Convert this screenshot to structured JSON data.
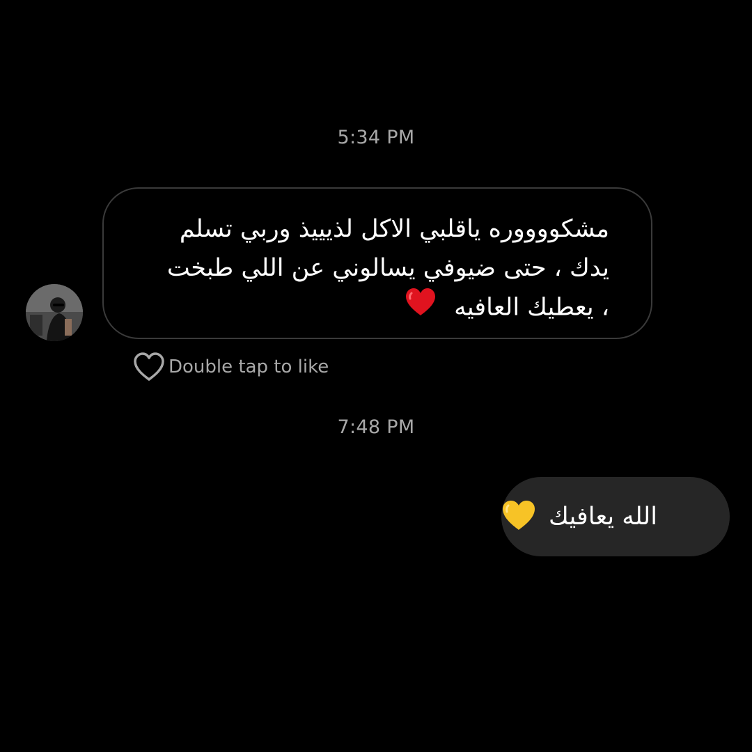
{
  "conversation": {
    "timestamp_1": "5:34 PM",
    "incoming_message": {
      "lines": [
        "مشكووووره ياقلبي الاكل لذيييذ وربي تسلم",
        "يدك ، حتى ضيوفي يسالوني عن اللي طبخت",
        "، يعطيك العافيه"
      ],
      "emoji": "red-heart-emoji",
      "like_hint": "Double tap to like"
    },
    "timestamp_2": "7:48 PM",
    "outgoing_message": {
      "text": "الله يعافيك",
      "emoji": "yellow-heart-emoji"
    }
  },
  "colors": {
    "background": "#000000",
    "timestamp": "#a8a8a8",
    "incoming_border": "#3a3a3a",
    "outgoing_bubble": "#262626",
    "red_heart": "#e0131f",
    "yellow_heart": "#f7c326"
  }
}
